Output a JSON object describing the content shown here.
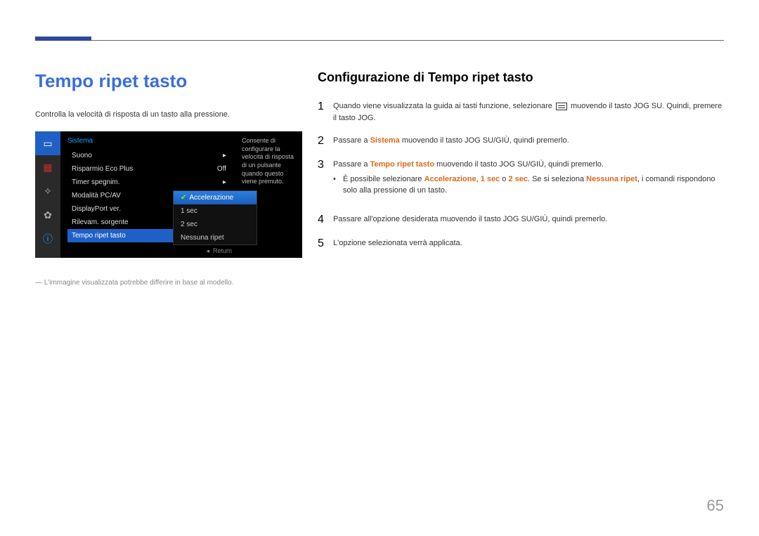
{
  "title": "Tempo ripet tasto",
  "subtitle": "Configurazione di Tempo ripet tasto",
  "intro": "Controlla la velocità di risposta di un tasto alla pressione.",
  "osd": {
    "section": "Sistema",
    "items": [
      {
        "label": "Suono",
        "value": "▸"
      },
      {
        "label": "Risparmio Eco Plus",
        "value": "Off"
      },
      {
        "label": "Timer spegnim.",
        "value": "▸"
      },
      {
        "label": "Modalità PC/AV",
        "value": "▸"
      },
      {
        "label": "DisplayPort ver.",
        "value": ""
      },
      {
        "label": "Rilevam. sorgente",
        "value": ""
      },
      {
        "label": "Tempo ripet tasto",
        "value": "",
        "selected": true
      }
    ],
    "popup": {
      "options": [
        {
          "label": "Accelerazione",
          "selected": true
        },
        {
          "label": "1 sec"
        },
        {
          "label": "2 sec"
        },
        {
          "label": "Nessuna ripet"
        }
      ]
    },
    "desc": "Consente di configurare la velocità di risposta di un pulsante quando questo viene premuto.",
    "return": "Return",
    "return_glyph": "◂"
  },
  "footnote_dash": "―",
  "footnote": "L'immagine visualizzata potrebbe differire in base al modello.",
  "steps": [
    {
      "num": "1",
      "pre": "Quando viene visualizzata la guida ai tasti funzione, selezionare ",
      "post": " muovendo il tasto JOG SU. Quindi, premere il tasto JOG.",
      "glyph": true
    },
    {
      "num": "2",
      "pre": "Passare a ",
      "hl": "Sistema",
      "post": " muovendo il tasto JOG SU/GIÙ, quindi premerlo."
    },
    {
      "num": "3",
      "pre": "Passare a ",
      "hl": "Tempo ripet tasto",
      "post": " muovendo il tasto JOG SU/GIÙ, quindi premerlo.",
      "bullet": {
        "t1": "È possibile selezionare ",
        "h1": "Accelerazione",
        "t2": ", ",
        "h2": "1 sec",
        "t3": " o ",
        "h3": "2 sec",
        "t4": ". Se si seleziona ",
        "h4": "Nessuna ripet",
        "t5": ", i comandi rispondono solo alla pressione di un tasto."
      }
    },
    {
      "num": "4",
      "plain": "Passare all'opzione desiderata muovendo il tasto JOG SU/GIÙ, quindi premerlo."
    },
    {
      "num": "5",
      "plain": "L'opzione selezionata verrà applicata."
    }
  ],
  "page_number": "65",
  "icons": {
    "display": "▭",
    "picture": "▦",
    "adjust": "✧",
    "settings": "✿",
    "info": "ⓘ"
  }
}
